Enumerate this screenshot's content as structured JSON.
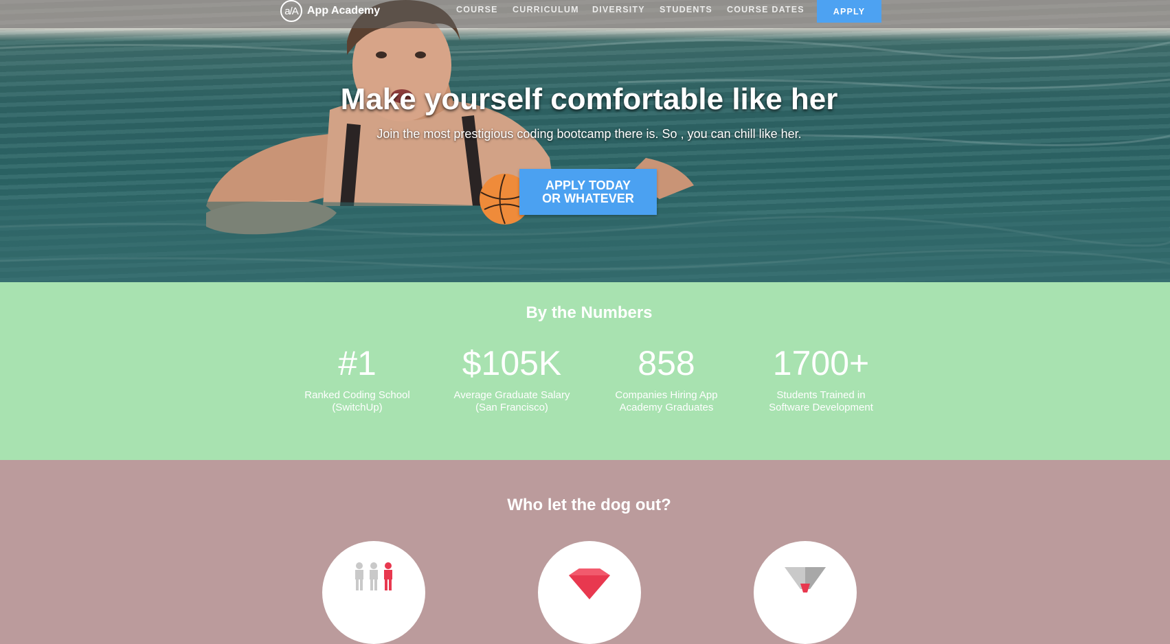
{
  "nav": {
    "brand_logo": "a/A",
    "brand_name": "App Academy",
    "links": [
      "COURSE",
      "CURRICULUM",
      "DIVERSITY",
      "STUDENTS",
      "COURSE DATES"
    ],
    "apply_label": "APPLY"
  },
  "hero": {
    "title": "Make yourself comfortable like her",
    "subtitle": "Join the most prestigious coding bootcamp there is. So , you can chill like her.",
    "cta_line1": "APPLY TODAY",
    "cta_line2": "OR WHATEVER"
  },
  "numbers": {
    "title": "By the Numbers",
    "stats": [
      {
        "value": "#1",
        "label": "Ranked Coding School (SwitchUp)"
      },
      {
        "value": "$105K",
        "label": "Average Graduate Salary (San Francisco)"
      },
      {
        "value": "858",
        "label": "Companies Hiring App Academy Graduates"
      },
      {
        "value": "1700+",
        "label": "Students Trained in Software Development"
      }
    ]
  },
  "who": {
    "title": "Who let the dog out?",
    "icons": [
      "people-icon",
      "gem-icon",
      "funnel-icon"
    ]
  },
  "colors": {
    "accent_blue": "#4da2f2",
    "numbers_bg": "#a8e2b0",
    "who_bg": "#bb9b9c"
  }
}
